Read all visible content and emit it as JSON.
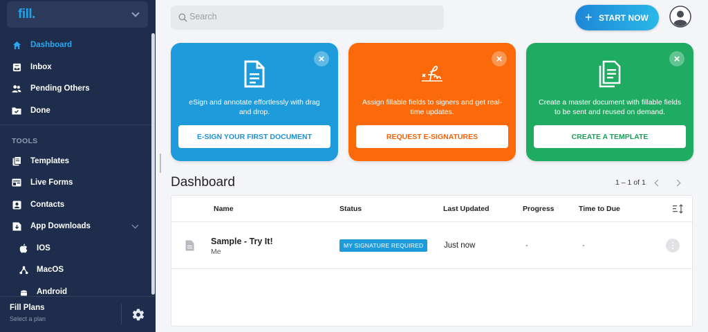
{
  "brand": {
    "logo": "fill."
  },
  "nav": {
    "items": [
      {
        "label": "Dashboard"
      },
      {
        "label": "Inbox"
      },
      {
        "label": "Pending Others"
      },
      {
        "label": "Done"
      }
    ],
    "tools_header": "TOOLS",
    "tools": [
      {
        "label": "Templates"
      },
      {
        "label": "Live Forms"
      },
      {
        "label": "Contacts"
      },
      {
        "label": "App Downloads"
      }
    ],
    "downloads": [
      {
        "label": "IOS"
      },
      {
        "label": "MacOS"
      },
      {
        "label": "Android"
      }
    ]
  },
  "plan": {
    "title": "Fill Plans",
    "subtitle": "Select a plan"
  },
  "search": {
    "placeholder": "Search"
  },
  "header": {
    "start_label": "START NOW"
  },
  "cards": [
    {
      "desc": "eSign and annotate effortlessly with drag and drop.",
      "button": "E-SIGN YOUR FIRST DOCUMENT",
      "color": "#1e9bdb"
    },
    {
      "desc": "Assign fillable fields to signers and get real-time updates.",
      "button": "REQUEST E-SIGNATURES",
      "color": "#fa6a0a"
    },
    {
      "desc": "Create a master document with fillable fields to be sent and reused on demand.",
      "button": "CREATE A TEMPLATE",
      "color": "#1fac62"
    }
  ],
  "dashboard": {
    "title": "Dashboard",
    "pagination": "1 – 1 of 1",
    "columns": {
      "name": "Name",
      "status": "Status",
      "updated": "Last Updated",
      "progress": "Progress",
      "due": "Time to Due"
    },
    "rows": [
      {
        "name": "Sample - Try It!",
        "owner": "Me",
        "status": "MY SIGNATURE REQUIRED",
        "updated": "Just now",
        "progress": "-",
        "due": "-"
      }
    ]
  },
  "colors": {
    "sidebar": "#1f2d4d",
    "accent": "#2aa7ef"
  }
}
